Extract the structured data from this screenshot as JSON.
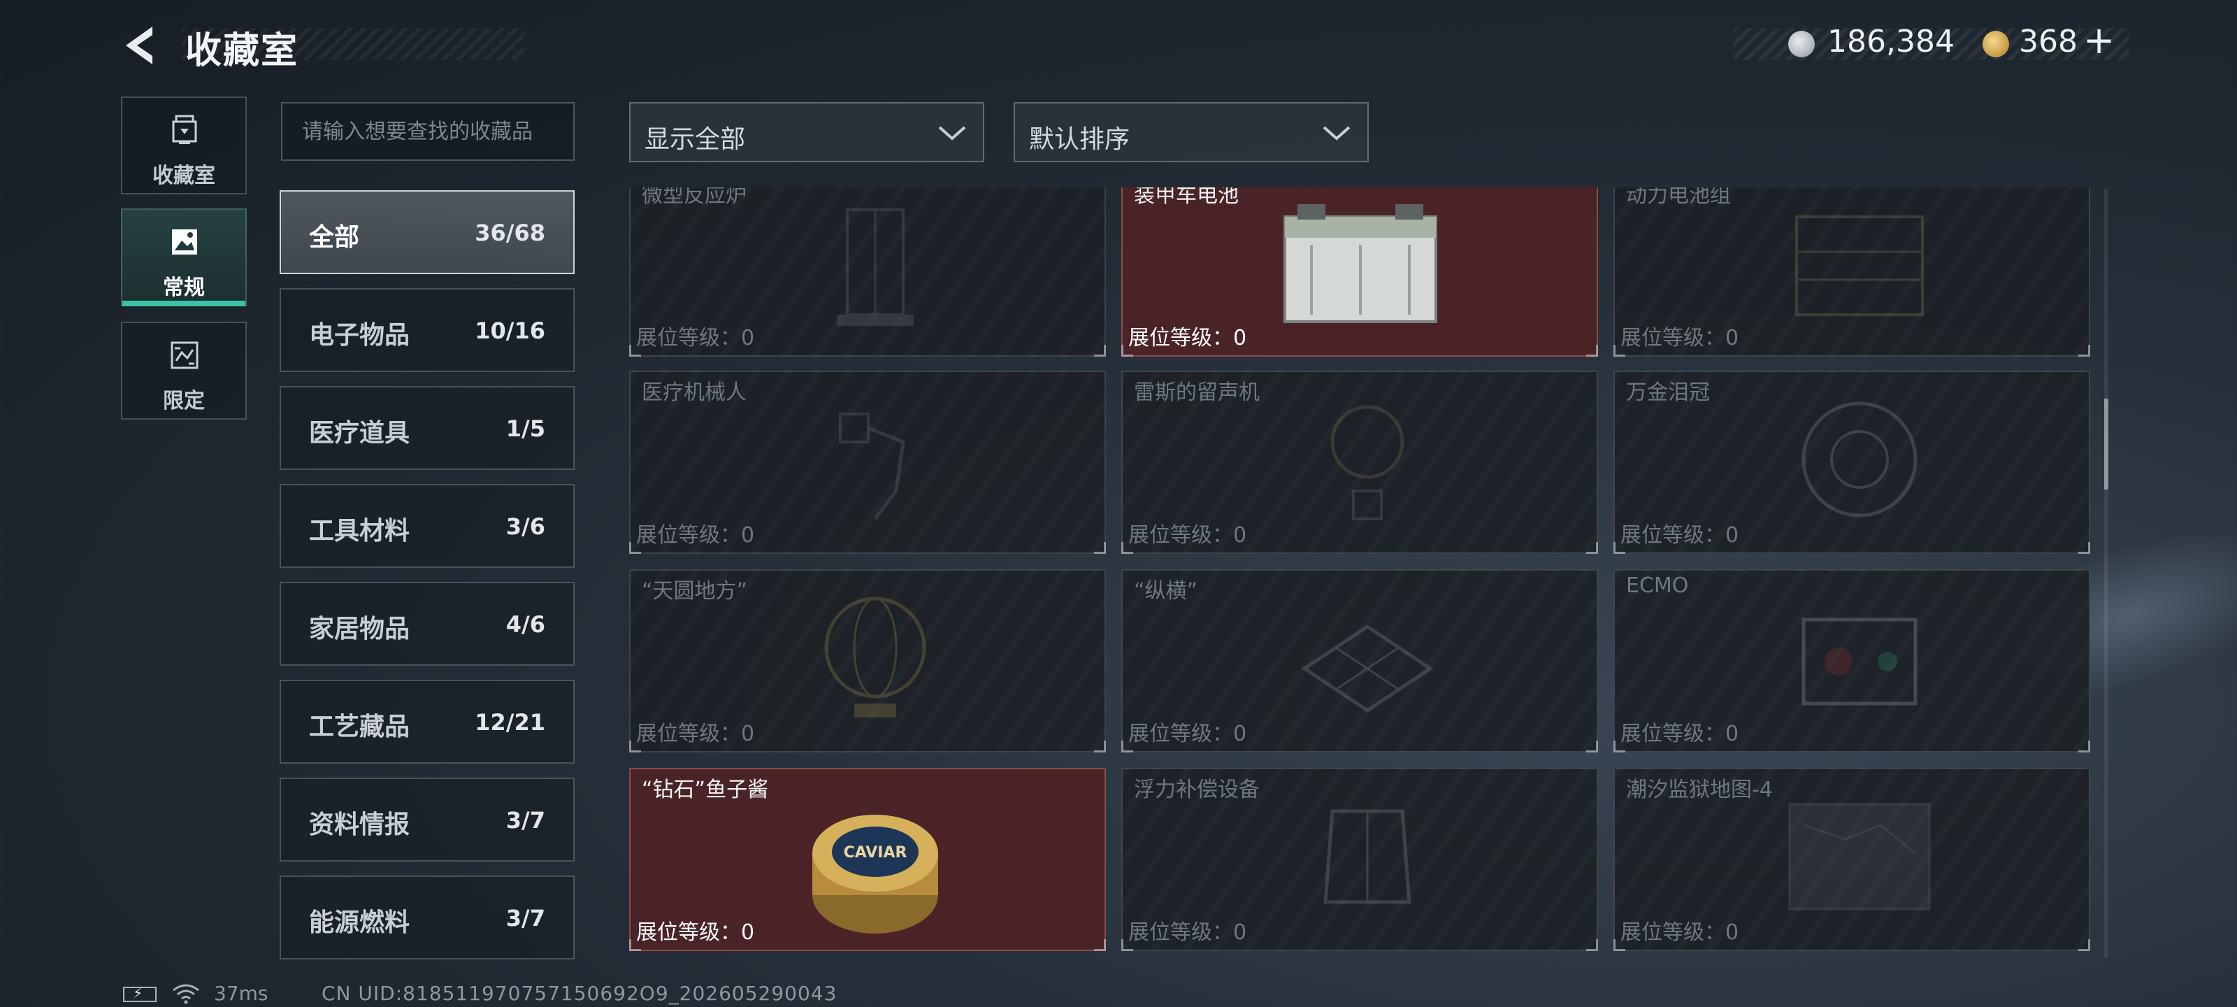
{
  "header": {
    "title": "收藏室",
    "currency_silver": "186,384",
    "currency_gold": "368",
    "plus": "+"
  },
  "nav": [
    {
      "label": "收藏室",
      "icon": "trophy-icon",
      "active": false
    },
    {
      "label": "常规",
      "icon": "image-card-icon",
      "active": true
    },
    {
      "label": "限定",
      "icon": "limited-card-icon",
      "active": false
    }
  ],
  "search": {
    "placeholder": "请输入想要查找的收藏品"
  },
  "filters": {
    "display": "显示全部",
    "sort": "默认排序"
  },
  "categories": [
    {
      "name": "全部",
      "count": "36/68",
      "active": true
    },
    {
      "name": "电子物品",
      "count": "10/16"
    },
    {
      "name": "医疗道具",
      "count": "1/5"
    },
    {
      "name": "工具材料",
      "count": "3/6"
    },
    {
      "name": "家居物品",
      "count": "4/6"
    },
    {
      "name": "工艺藏品",
      "count": "12/21"
    },
    {
      "name": "资料情报",
      "count": "3/7"
    },
    {
      "name": "能源燃料",
      "count": "3/7"
    }
  ],
  "level_prefix": "展位等级：",
  "items": [
    {
      "name": "微型反应炉",
      "level": "0",
      "owned": false,
      "icon": "reactor-icon"
    },
    {
      "name": "装甲车电池",
      "level": "0",
      "owned": true,
      "icon": "battery-icon"
    },
    {
      "name": "动力电池组",
      "level": "0",
      "owned": false,
      "icon": "battery-pack-icon"
    },
    {
      "name": "医疗机械人",
      "level": "0",
      "owned": false,
      "icon": "robot-icon"
    },
    {
      "name": "雷斯的留声机",
      "level": "0",
      "owned": false,
      "icon": "gramophone-icon"
    },
    {
      "name": "万金泪冠",
      "level": "0",
      "owned": false,
      "icon": "crown-icon"
    },
    {
      "name": "“天圆地方”",
      "level": "0",
      "owned": false,
      "icon": "globe-icon"
    },
    {
      "name": "“纵横”",
      "level": "0",
      "owned": false,
      "icon": "chessboard-icon"
    },
    {
      "name": "ECMO",
      "level": "0",
      "owned": false,
      "icon": "ecmo-icon"
    },
    {
      "name": "“钻石”鱼子酱",
      "level": "0",
      "owned": true,
      "icon": "caviar-tin-icon",
      "tin_text": "CAVIAR"
    },
    {
      "name": "浮力补偿设备",
      "level": "0",
      "owned": false,
      "icon": "buoyancy-device-icon"
    },
    {
      "name": "潮汐监狱地图-4",
      "level": "0",
      "owned": false,
      "icon": "map-icon"
    }
  ],
  "footer": {
    "ping": "37ms",
    "uid": "CN UID:818511970757150692O9_202605290043"
  }
}
